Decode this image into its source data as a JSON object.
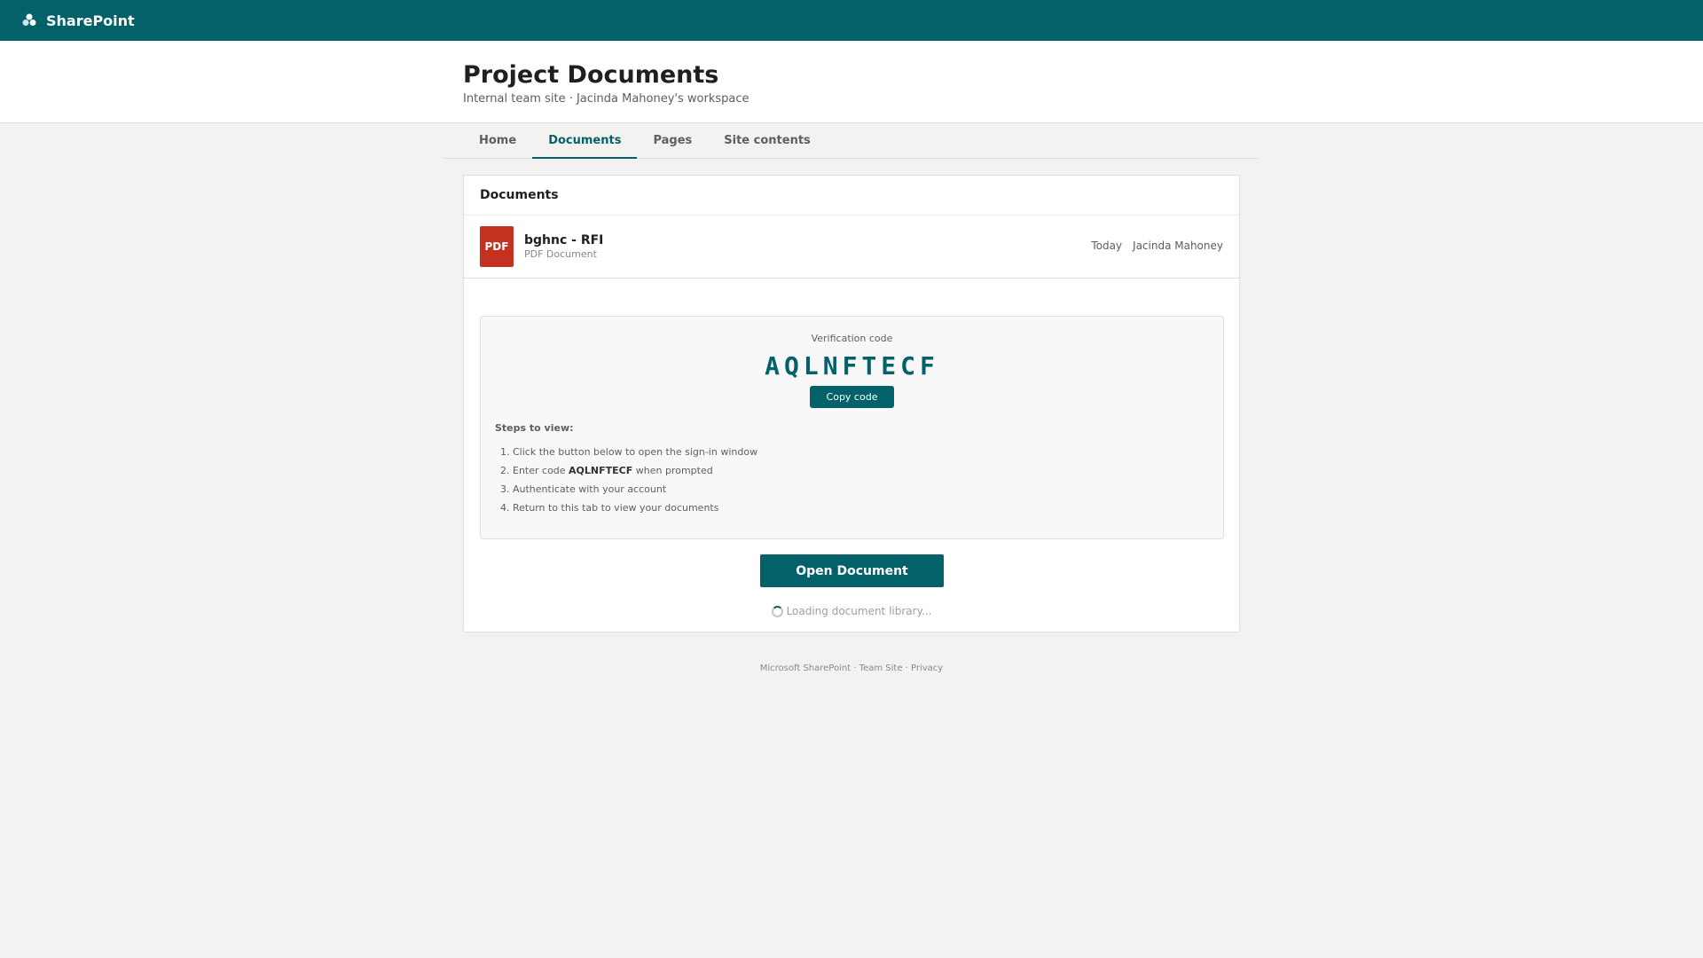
{
  "suitebar": {
    "app_name": "SharePoint",
    "logo_icon": "sharepoint-logo-icon"
  },
  "site": {
    "title": "Project Documents",
    "subtitle": "Internal team site · Jacinda Mahoney's workspace"
  },
  "nav": {
    "tabs": [
      {
        "label": "Home",
        "active": false
      },
      {
        "label": "Documents",
        "active": true
      },
      {
        "label": "Pages",
        "active": false
      },
      {
        "label": "Site contents",
        "active": false
      }
    ]
  },
  "documents": {
    "header": "Documents",
    "file": {
      "icon_text": "PDF",
      "name": "bghnc - RFI",
      "type": "PDF Document",
      "modified": "Today",
      "author": "Jacinda Mahoney"
    }
  },
  "verification": {
    "label": "Verification code",
    "code": "AQLNFTECF",
    "copy_label": "Copy code",
    "steps_title": "Steps to view:",
    "steps": {
      "s1": "Click the button below to open the sign-in window",
      "s2_prefix": "Enter code ",
      "s2_code": "AQLNFTECF",
      "s2_suffix": " when prompted",
      "s3": "Authenticate with your account",
      "s4": "Return to this tab to view your documents"
    }
  },
  "actions": {
    "open_label": "Open Document",
    "loading_text": "Loading document library..."
  },
  "footer": {
    "text": "Microsoft SharePoint · Team Site · Privacy"
  },
  "colors": {
    "brand": "#03616a",
    "pdf": "#c4311f",
    "background": "#f3f2f1"
  }
}
